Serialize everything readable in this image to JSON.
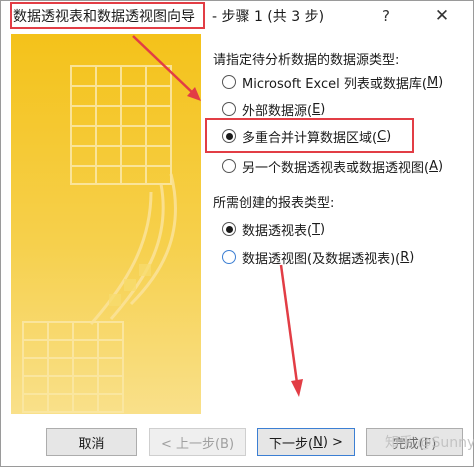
{
  "titlebar": {
    "title": "数据透视表和数据透视图向导",
    "step": "- 步骤 1 (共 3 步)",
    "help_glyph": "?",
    "close_glyph": "✕"
  },
  "datasource": {
    "label": "请指定待分析数据的数据源类型:",
    "options": [
      {
        "text": "Microsoft Excel 列表或数据库(",
        "key": "M",
        "suffix": ")",
        "selected": false
      },
      {
        "text": "外部数据源(",
        "key": "E",
        "suffix": ")",
        "selected": false
      },
      {
        "text": "多重合并计算数据区域(",
        "key": "C",
        "suffix": ")",
        "selected": true
      },
      {
        "text": "另一个数据透视表或数据透视图(",
        "key": "A",
        "suffix": ")",
        "selected": false
      }
    ]
  },
  "reporttype": {
    "label": "所需创建的报表类型:",
    "options": [
      {
        "text": "数据透视表(",
        "key": "T",
        "suffix": ")",
        "selected": true
      },
      {
        "text": "数据透视图(及数据透视表)(",
        "key": "R",
        "suffix": ")",
        "selected": false
      }
    ]
  },
  "buttons": {
    "cancel": "取消",
    "back": "< 上一步(B)",
    "next_prefix": "下一步(",
    "next_key": "N",
    "next_suffix": ") >",
    "finish": "完成(F)"
  },
  "watermark": "知乎 @Sunny",
  "colors": {
    "highlight": "#e23d45",
    "illustration": "#f5c518",
    "accent_blue": "#3c7fd3"
  }
}
